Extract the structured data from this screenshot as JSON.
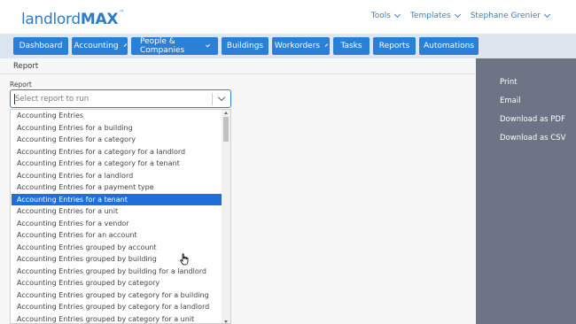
{
  "app": {
    "logo_light": "landlord",
    "logo_bold": "MAX",
    "logo_tm": "™"
  },
  "top_menu": [
    {
      "label": "Tools"
    },
    {
      "label": "Templates"
    },
    {
      "label": "Stephane Grenier"
    }
  ],
  "nav": [
    {
      "label": "Dashboard",
      "has_dropdown": false
    },
    {
      "label": "Accounting",
      "has_dropdown": true
    },
    {
      "label": "People & Companies",
      "has_dropdown": true
    },
    {
      "label": "Buildings",
      "has_dropdown": false
    },
    {
      "label": "Workorders",
      "has_dropdown": true
    },
    {
      "label": "Tasks",
      "has_dropdown": false
    },
    {
      "label": "Reports",
      "has_dropdown": false
    },
    {
      "label": "Automations",
      "has_dropdown": false
    }
  ],
  "main": {
    "section_title": "Report",
    "field_label": "Report",
    "select_placeholder": "Select report to run",
    "options": [
      "Accounting Entries",
      "Accounting Entries for a building",
      "Accounting Entries for a category",
      "Accounting Entries for a category for a landlord",
      "Accounting Entries for a category for a tenant",
      "Accounting Entries for a landlord",
      "Accounting Entries for a payment type",
      "Accounting Entries for a tenant",
      "Accounting Entries for a unit",
      "Accounting Entries for a vendor",
      "Accounting Entries for an account",
      "Accounting Entries grouped by account",
      "Accounting Entries grouped by building",
      "Accounting Entries grouped by building for a landlord",
      "Accounting Entries grouped by category",
      "Accounting Entries grouped by category for a building",
      "Accounting Entries grouped by category for a landlord",
      "Accounting Entries grouped by category for a unit"
    ],
    "selected_index": 7
  },
  "right_panel": [
    {
      "label": "Print"
    },
    {
      "label": "Email"
    },
    {
      "label": "Download as PDF"
    },
    {
      "label": "Download as CSV"
    }
  ],
  "colors": {
    "brand": "#2e7cc2",
    "nav_button": "#2a7fd6",
    "highlight": "#1e6fd9",
    "side_panel": "#6c7485"
  }
}
